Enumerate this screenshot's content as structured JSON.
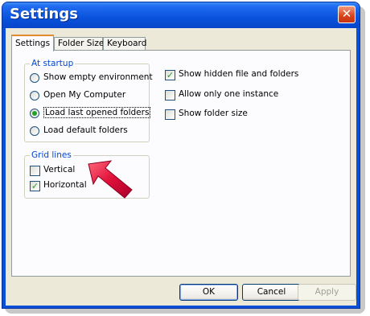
{
  "window": {
    "title": "Settings",
    "close_glyph": "✕"
  },
  "tabs": [
    {
      "label": "Settings",
      "active": true
    },
    {
      "label": "Folder Sizes",
      "active": false
    },
    {
      "label": "Keyboard",
      "active": false
    }
  ],
  "startup": {
    "legend": "At startup",
    "options": [
      {
        "label": "Show empty environment",
        "selected": false
      },
      {
        "label": "Open My Computer",
        "selected": false
      },
      {
        "label": "Load last opened folders",
        "selected": true
      },
      {
        "label": "Load default folders",
        "selected": false
      }
    ]
  },
  "grid_lines": {
    "legend": "Grid lines",
    "options": [
      {
        "label": "Vertical",
        "checked": false
      },
      {
        "label": "Horizontal",
        "checked": true
      }
    ]
  },
  "right_options": [
    {
      "label": "Show hidden file and folders",
      "checked": true
    },
    {
      "label": "Allow only one instance",
      "checked": false
    },
    {
      "label": "Show folder size",
      "checked": false
    }
  ],
  "buttons": {
    "ok": "OK",
    "cancel": "Cancel",
    "apply": "Apply"
  },
  "icons": {
    "check_mark": "✓",
    "annotation_arrow": "red-arrow-icon"
  },
  "colors": {
    "title_bar": "#0a52dc",
    "legend_text": "#0046d5",
    "arrow": "#e0103a",
    "active_tab_accent": "#e68b2c"
  }
}
